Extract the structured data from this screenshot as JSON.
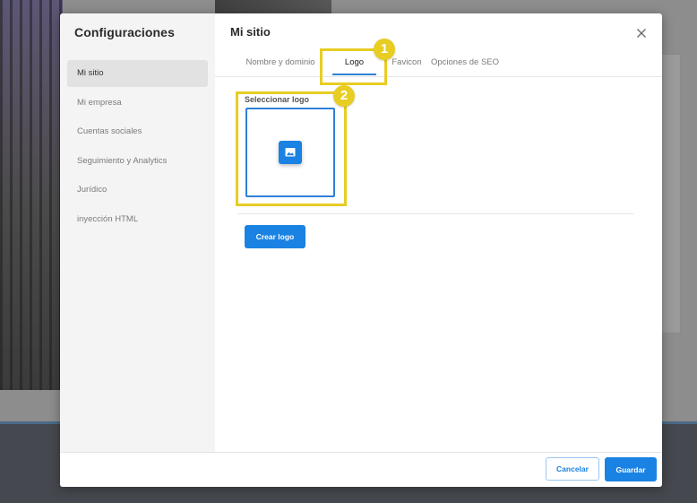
{
  "sidebar": {
    "title": "Configuraciones",
    "items": [
      {
        "label": "Mi sitio"
      },
      {
        "label": "Mi empresa"
      },
      {
        "label": "Cuentas sociales"
      },
      {
        "label": "Seguimiento y Analytics"
      },
      {
        "label": "Jurídico"
      },
      {
        "label": "inyección HTML"
      }
    ],
    "active_index": 0
  },
  "main": {
    "title": "Mi sitio",
    "tabs": [
      {
        "label": "Nombre y dominio"
      },
      {
        "label": "Logo"
      },
      {
        "label": "Favicon"
      },
      {
        "label": "Opciones de SEO"
      }
    ],
    "active_tab": "Logo",
    "logo_section": {
      "label": "Seleccionar logo",
      "icon": "image-icon"
    },
    "create_logo_button": "Crear logo"
  },
  "footer": {
    "cancel_label": "Cancelar",
    "save_label": "Guardar"
  },
  "annotations": {
    "marker_1": "1",
    "marker_2": "2"
  },
  "colors": {
    "accent": "#1a82e2",
    "highlight": "#e8cd22"
  }
}
